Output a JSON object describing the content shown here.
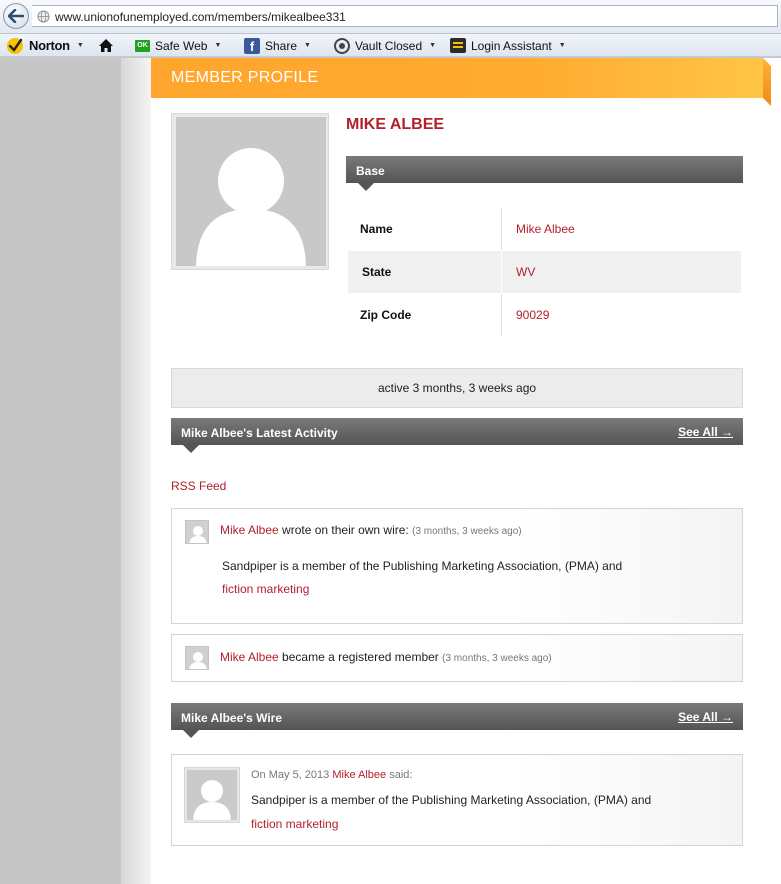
{
  "browser": {
    "url": "www.unionofunemployed.com/members/mikealbee331"
  },
  "toolbar": {
    "norton": "Norton",
    "safe_web": "Safe Web",
    "ok_badge": "OK",
    "fb_badge": "f",
    "share": "Share",
    "vault": "Vault Closed",
    "login": "Login Assistant"
  },
  "header": {
    "title": "MEMBER PROFILE"
  },
  "profile": {
    "name": "MIKE ALBEE",
    "base_title": "Base",
    "fields": [
      {
        "label": "Name",
        "value": "Mike Albee"
      },
      {
        "label": "State",
        "value": "WV"
      },
      {
        "label": "Zip Code",
        "value": "90029"
      }
    ],
    "active_status": "active 3 months, 3 weeks ago"
  },
  "activity": {
    "title": "Mike Albee's Latest Activity",
    "see_all": "See All →",
    "rss": "RSS Feed",
    "items": [
      {
        "author": "Mike Albee",
        "action": "wrote on their own wire:",
        "time": "(3 months, 3 weeks ago)",
        "body": "Sandpiper is a member of the Publishing Marketing Association, (PMA) and",
        "link": "fiction marketing"
      },
      {
        "author": "Mike Albee",
        "action": "became a registered member",
        "time": "(3 months, 3 weeks ago)"
      }
    ]
  },
  "wire": {
    "title": "Mike Albee's Wire",
    "see_all": "See All →",
    "post": {
      "date_prefix": "On May 5, 2013",
      "author": "Mike Albee",
      "said": "said:",
      "body": "Sandpiper is a member of the Publishing Marketing Association, (PMA) and",
      "link": "fiction marketing"
    }
  },
  "colors": {
    "accent_red": "#b0212b",
    "header_orange": "#ffa52d",
    "bar_dark": "#5a5a5a"
  }
}
